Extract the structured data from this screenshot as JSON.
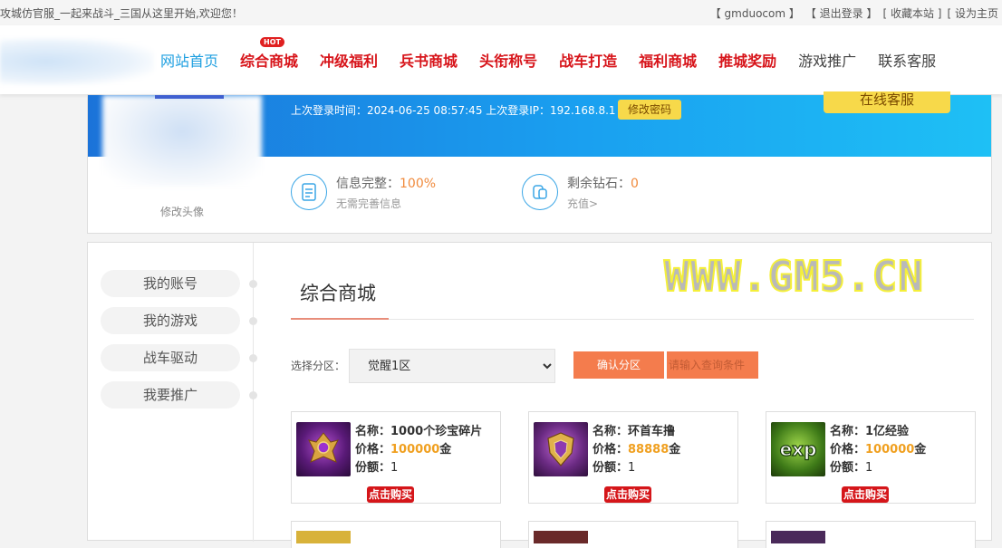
{
  "topbar": {
    "welcome": "攻城仿官服_一起来战斗_三国从这里开始,欢迎您！",
    "links": [
      "【 gmduocom 】",
      "【 退出登录 】",
      "[ 收藏本站 ]",
      "[ 设为主页"
    ]
  },
  "nav": {
    "items": [
      "网站首页",
      "综合商城",
      "冲级福利",
      "兵书商城",
      "头衔称号",
      "战车打造",
      "福利商城",
      "推城奖励",
      "游戏推广",
      "联系客服"
    ],
    "hot_badge": "HOT"
  },
  "profile": {
    "last_login": "上次登录时间：2024-06-25 08:57:45 上次登录IP：192.168.8.1",
    "change_password": "修改密码",
    "online_service": "在线客服",
    "change_avatar": "修改头像",
    "info_label": "信息完整：",
    "info_value": "100%",
    "info_sub": "无需完善信息",
    "diamond_label": "剩余钻石：",
    "diamond_value": "0",
    "diamond_sub": "充值>"
  },
  "sidebar": {
    "items": [
      "我的账号",
      "我的游戏",
      "战车驱动",
      "我要推广"
    ]
  },
  "content": {
    "title": "综合商城",
    "zone_label": "选择分区：",
    "zone_selected": "觉醒1区",
    "confirm": "确认分区",
    "query_placeholder": "请输入查询条件",
    "watermark": "WWW.GM5.CN"
  },
  "product_labels": {
    "name": "名称：",
    "price": "价格：",
    "share": "份额：",
    "unit": "金",
    "buy": "点击购买"
  },
  "products": [
    {
      "name": "1000个珍宝碎片",
      "price": "100000",
      "share": "1",
      "icon": "purple-gem-emblem-icon"
    },
    {
      "name": "环首车撸",
      "price": "88888",
      "share": "1",
      "icon": "golden-shield-emblem-icon"
    },
    {
      "name": "1亿经验",
      "price": "100000",
      "share": "1",
      "icon": "exp-icon"
    }
  ],
  "colors": {
    "accent_blue": "#1e9fe0",
    "nav_red": "#d7141a",
    "orange": "#f47c4d",
    "price_gold": "#f0a020",
    "button_yellow": "#f7d94a"
  }
}
